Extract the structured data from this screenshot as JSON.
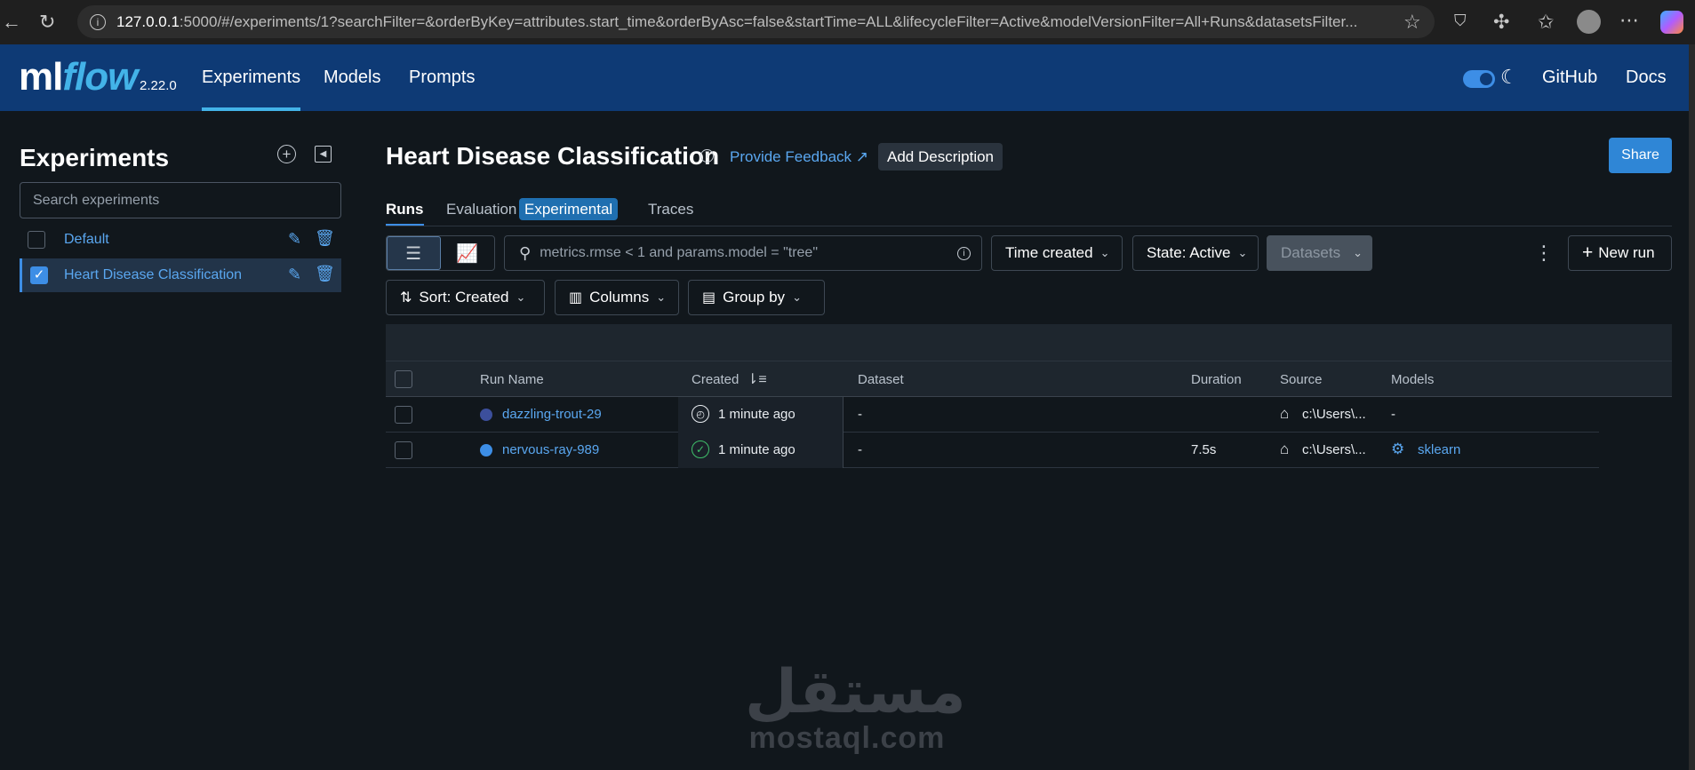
{
  "browser": {
    "url_host": "127.0.0.1",
    "url_rest": ":5000/#/experiments/1?searchFilter=&orderByKey=attributes.start_time&orderByAsc=false&startTime=ALL&lifecycleFilter=Active&modelVersionFilter=All+Runs&datasetsFilter..."
  },
  "header": {
    "logo_ml": "ml",
    "logo_flow": "flow",
    "version": "2.22.0",
    "nav": [
      "Experiments",
      "Models",
      "Prompts"
    ],
    "github": "GitHub",
    "docs": "Docs"
  },
  "sidebar": {
    "title": "Experiments",
    "search_placeholder": "Search experiments",
    "experiments": [
      {
        "name": "Default",
        "checked": false
      },
      {
        "name": "Heart Disease Classification",
        "checked": true
      }
    ]
  },
  "main": {
    "title": "Heart Disease Classification",
    "feedback": "Provide Feedback",
    "add_description": "Add Description",
    "share": "Share",
    "tabs": {
      "runs": "Runs",
      "evaluation": "Evaluation",
      "experimental_badge": "Experimental",
      "traces": "Traces"
    },
    "search_placeholder": "metrics.rmse < 1 and params.model = \"tree\"",
    "time_created": "Time created",
    "state": "State: Active",
    "datasets": "Datasets",
    "new_run": "New run",
    "sort": "Sort: Created",
    "columns": "Columns",
    "group_by": "Group by"
  },
  "table": {
    "headers": {
      "run_name": "Run Name",
      "created": "Created",
      "dataset": "Dataset",
      "duration": "Duration",
      "source": "Source",
      "models": "Models"
    },
    "rows": [
      {
        "run_name": "dazzling-trout-29",
        "color": "#3c4f9c",
        "status": "running",
        "created": "1 minute ago",
        "dataset": "-",
        "duration": "",
        "source": "c:\\Users\\...",
        "models": "-"
      },
      {
        "run_name": "nervous-ray-989",
        "color": "#3d8ee6",
        "status": "finished",
        "created": "1 minute ago",
        "dataset": "-",
        "duration": "7.5s",
        "source": "c:\\Users\\...",
        "models": "sklearn"
      }
    ]
  },
  "watermark": {
    "arabic": "مستقل",
    "latin": "mostaql.com"
  }
}
